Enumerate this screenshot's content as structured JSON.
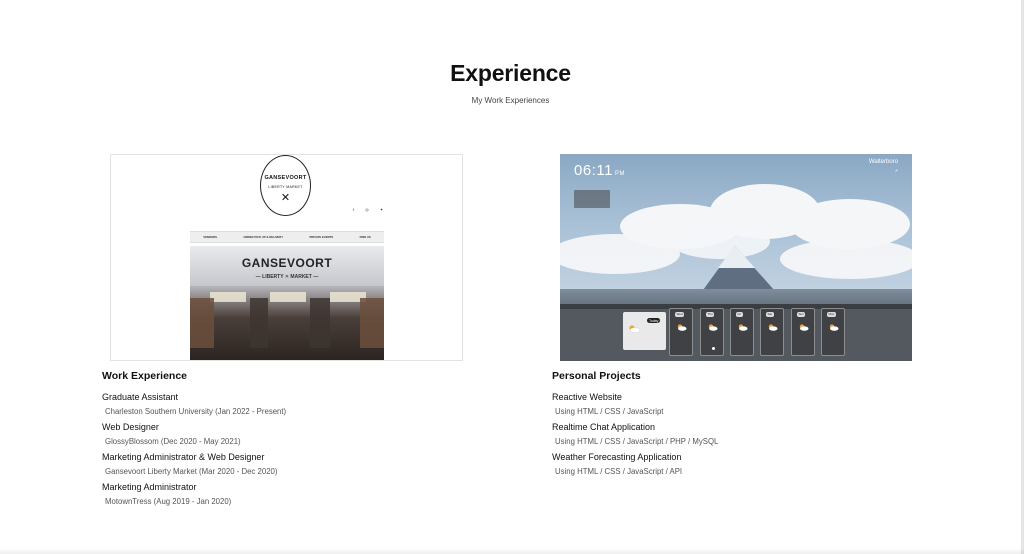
{
  "header": {
    "title": "Experience",
    "subtitle": "My Work Experiences"
  },
  "left_screenshot": {
    "logo_name": "GANSEVOORT",
    "logo_sub": "LIBERTY MARKET",
    "nav": [
      "VENDORS",
      "ORDER PICK UP & DELIVERY",
      "PRIVATE EVENTS",
      "FIND US"
    ],
    "sign_main": "GANSEVOORT",
    "sign_sub": "— LIBERTY ✕ MARKET —"
  },
  "right_screenshot": {
    "time": "06:11",
    "ampm": "PM",
    "city": "Walterboro",
    "today_badge": "Today",
    "days": [
      "Wed",
      "Thu",
      "Fri",
      "Sat",
      "Sun",
      "Mon"
    ]
  },
  "work": {
    "heading": "Work Experience",
    "items": [
      {
        "title": "Graduate Assistant",
        "sub": "Charleston Southern University (Jan 2022 - Present)"
      },
      {
        "title": "Web Designer",
        "sub": "GlossyBlossom (Dec 2020 - May 2021)"
      },
      {
        "title": "Marketing Administrator & Web Designer",
        "sub": "Gansevoort Liberty Market (Mar 2020 - Dec 2020)"
      },
      {
        "title": "Marketing Administrator",
        "sub": "MotownTress (Aug 2019 - Jan 2020)"
      }
    ]
  },
  "projects": {
    "heading": "Personal Projects",
    "items": [
      {
        "title": "Reactive Website",
        "sub": "Using HTML / CSS / JavaScript"
      },
      {
        "title": "Realtime Chat Application",
        "sub": "Using HTML / CSS / JavaScript / PHP / MySQL"
      },
      {
        "title": "Weather Forecasting Application",
        "sub": "Using HTML / CSS / JavaScript / API"
      }
    ]
  }
}
